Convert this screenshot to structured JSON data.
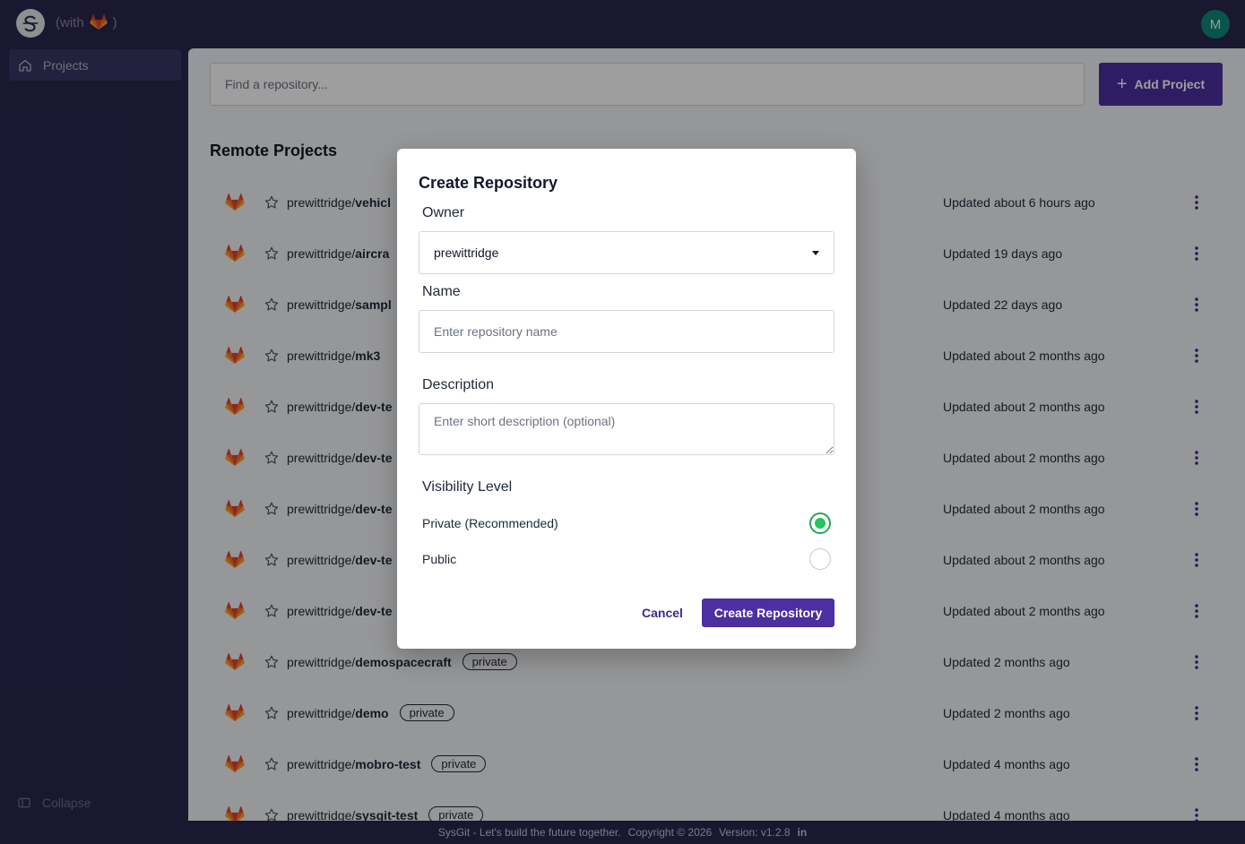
{
  "app": {
    "with_text": "(with",
    "with_close": ")",
    "avatar_initial": "M",
    "logo_icon": "sysgit-logo-icon",
    "partner_icon": "gitlab-fox-icon"
  },
  "sidebar": {
    "items": [
      {
        "label": "Projects",
        "icon": "home-icon"
      }
    ],
    "collapse_label": "Collapse"
  },
  "main": {
    "search_placeholder": "Find a repository...",
    "add_project_label": "Add Project",
    "section_title": "Remote Projects",
    "projects": [
      {
        "owner": "prewittridge/",
        "repo": "vehicl",
        "badge": "",
        "updated": "Updated about 6 hours ago"
      },
      {
        "owner": "prewittridge/",
        "repo": "aircra",
        "badge": "",
        "updated": "Updated 19 days ago"
      },
      {
        "owner": "prewittridge/",
        "repo": "sampl",
        "badge": "",
        "updated": "Updated 22 days ago"
      },
      {
        "owner": "prewittridge/",
        "repo": "mk3",
        "badge": "",
        "updated": "Updated about 2 months ago"
      },
      {
        "owner": "prewittridge/",
        "repo": "dev-te",
        "badge": "",
        "updated": "Updated about 2 months ago"
      },
      {
        "owner": "prewittridge/",
        "repo": "dev-te",
        "badge": "",
        "updated": "Updated about 2 months ago"
      },
      {
        "owner": "prewittridge/",
        "repo": "dev-te",
        "badge": "",
        "updated": "Updated about 2 months ago"
      },
      {
        "owner": "prewittridge/",
        "repo": "dev-te",
        "badge": "",
        "updated": "Updated about 2 months ago"
      },
      {
        "owner": "prewittridge/",
        "repo": "dev-te",
        "badge": "",
        "updated": "Updated about 2 months ago"
      },
      {
        "owner": "prewittridge/",
        "repo": "demospacecraft",
        "badge": "private",
        "updated": "Updated 2 months ago"
      },
      {
        "owner": "prewittridge/",
        "repo": "demo",
        "badge": "private",
        "updated": "Updated 2 months ago"
      },
      {
        "owner": "prewittridge/",
        "repo": "mobro-test",
        "badge": "private",
        "updated": "Updated 4 months ago"
      },
      {
        "owner": "prewittridge/",
        "repo": "sysgit-test",
        "badge": "private",
        "updated": "Updated 4 months ago"
      }
    ]
  },
  "footer": {
    "tagline": "SysGit - Let's build the future together.",
    "copyright": "Copyright © 2026",
    "version": "Version: v1.2.8",
    "linkedin": "in"
  },
  "modal": {
    "title": "Create Repository",
    "owner_label": "Owner",
    "owner_value": "prewittridge",
    "name_label": "Name",
    "name_placeholder": "Enter repository name",
    "description_label": "Description",
    "description_placeholder": "Enter short description (optional)",
    "visibility_label": "Visibility Level",
    "options": [
      {
        "label": "Private (Recommended)",
        "selected": true
      },
      {
        "label": "Public",
        "selected": false
      }
    ],
    "cancel_label": "Cancel",
    "create_label": "Create Repository"
  },
  "colors": {
    "brand": "#4c2fa0",
    "chrome": "#2a2650",
    "radio_selected": "#22c55e",
    "avatar": "#0f8a7a",
    "gitlab_orange": "#e24329"
  }
}
